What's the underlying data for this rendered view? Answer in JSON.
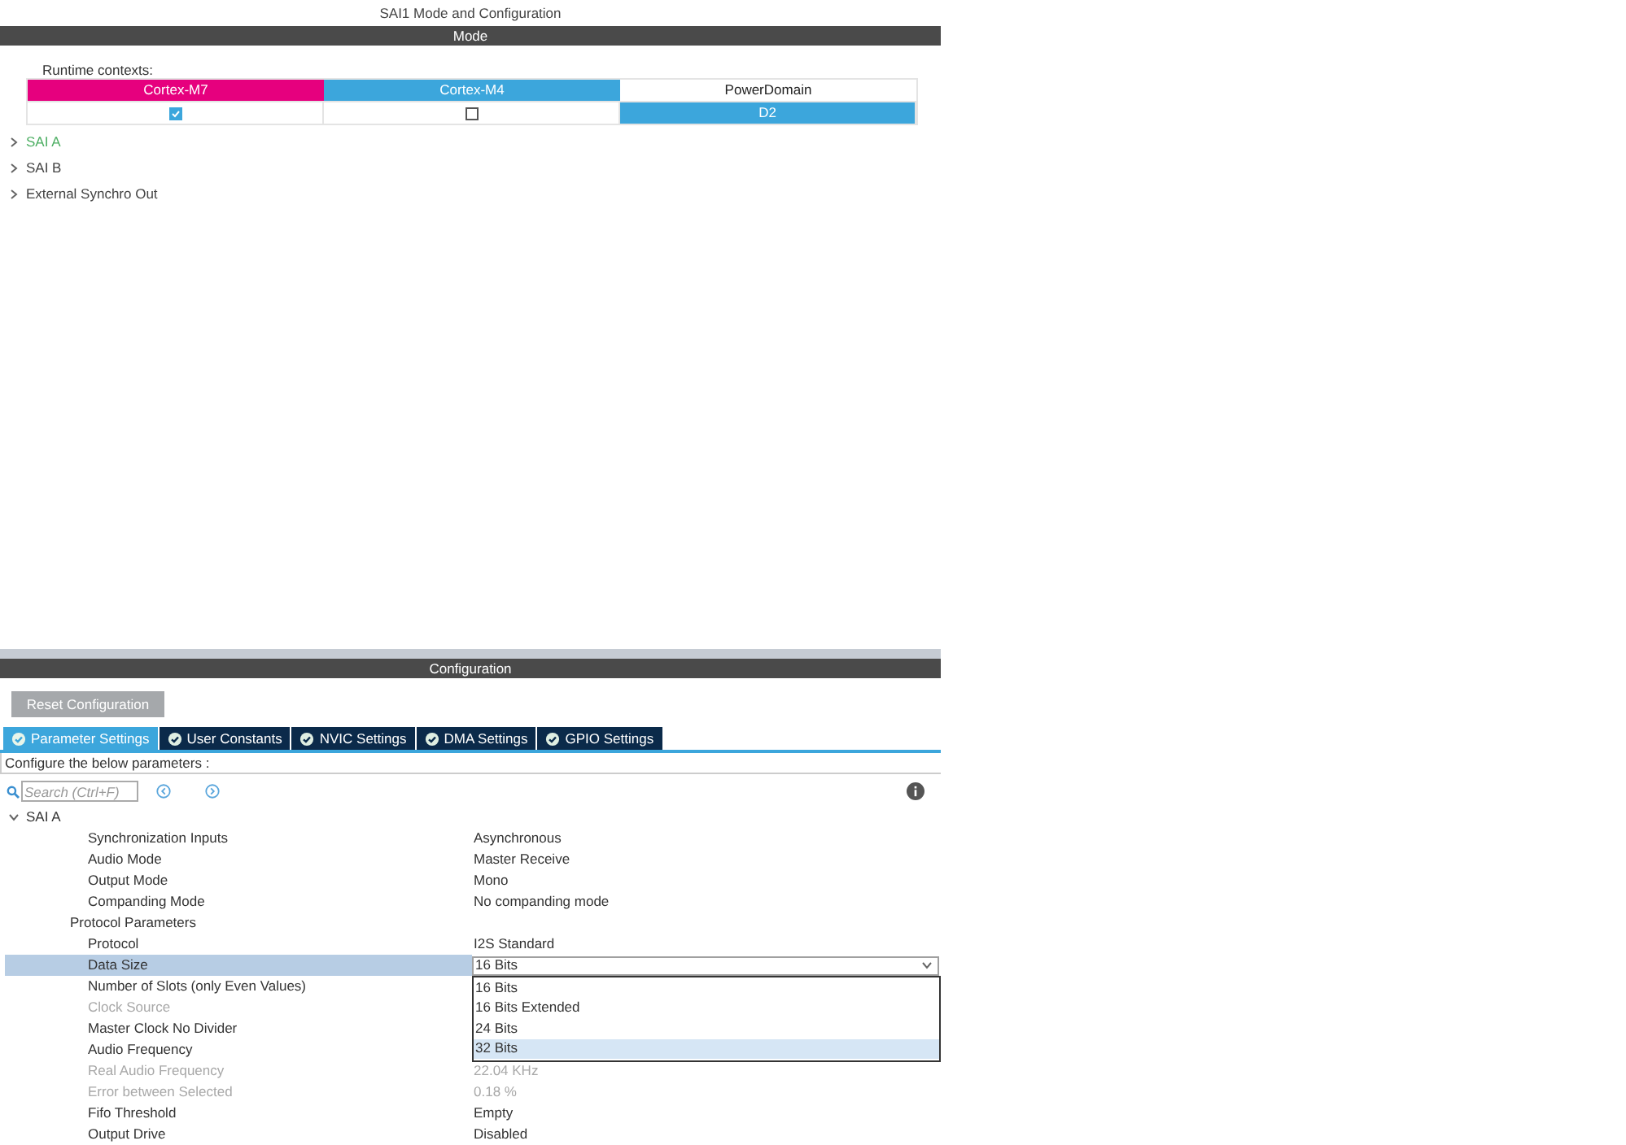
{
  "window": {
    "title": "SAI1 Mode and Configuration"
  },
  "mode": {
    "header": "Mode",
    "runtime_label": "Runtime contexts:",
    "contexts": [
      {
        "name": "Cortex-M7",
        "color": "#e6007e",
        "kind": "checkbox",
        "checked": true
      },
      {
        "name": "Cortex-M4",
        "color": "#3ca6dc",
        "kind": "checkbox",
        "checked": false
      },
      {
        "name": "PowerDomain",
        "kind": "value",
        "value": "D2"
      }
    ],
    "tree": [
      {
        "label": "SAI A",
        "configured": true,
        "expanded": false
      },
      {
        "label": "SAI B",
        "configured": false,
        "expanded": false
      },
      {
        "label": "External Synchro Out",
        "configured": false,
        "expanded": false
      }
    ]
  },
  "configuration": {
    "header": "Configuration",
    "reset_button": "Reset Configuration",
    "tabs": [
      {
        "label": "Parameter Settings",
        "selected": true
      },
      {
        "label": "User Constants",
        "selected": false
      },
      {
        "label": "NVIC Settings",
        "selected": false
      },
      {
        "label": "DMA Settings",
        "selected": false
      },
      {
        "label": "GPIO Settings",
        "selected": false
      }
    ],
    "hint": "Configure the below parameters :",
    "search": {
      "placeholder": "Search (Ctrl+F)"
    },
    "group": {
      "label": "SAI A",
      "expanded": true,
      "children": [
        {
          "label": "Synchronization Inputs",
          "value": "Asynchronous",
          "disabled": false,
          "selected": false
        },
        {
          "label": "Audio Mode",
          "value": "Master Receive",
          "disabled": false,
          "selected": false
        },
        {
          "label": "Output Mode",
          "value": "Mono",
          "disabled": false,
          "selected": false
        },
        {
          "label": "Companding Mode",
          "value": "No companding mode",
          "disabled": false,
          "selected": false
        },
        {
          "label": "Protocol Parameters",
          "kind": "group",
          "children": [
            {
              "label": "Protocol",
              "value": "I2S Standard",
              "disabled": false,
              "selected": false
            },
            {
              "label": "Data Size",
              "value": "16 Bits",
              "disabled": false,
              "selected": true,
              "dropdown": {
                "options": [
                  {
                    "label": "16 Bits",
                    "highlighted": false
                  },
                  {
                    "label": "16 Bits Extended",
                    "highlighted": false
                  },
                  {
                    "label": "24 Bits",
                    "highlighted": false
                  },
                  {
                    "label": "32 Bits",
                    "highlighted": true
                  }
                ]
              }
            },
            {
              "label": "Number of Slots (only Even Values)",
              "disabled": false,
              "selected": false
            },
            {
              "label": "Clock Source",
              "disabled": true,
              "selected": false
            },
            {
              "label": "Master Clock No Divider",
              "disabled": false,
              "selected": false
            },
            {
              "label": "Audio Frequency",
              "disabled": false,
              "selected": false
            },
            {
              "label": "Real Audio Frequency",
              "value": "22.04 KHz",
              "disabled": true,
              "selected": false
            },
            {
              "label": "Error between Selected",
              "value": "0.18 %",
              "disabled": true,
              "selected": false
            },
            {
              "label": "Fifo Threshold",
              "value": "Empty",
              "disabled": false,
              "selected": false
            },
            {
              "label": "Output Drive",
              "value": "Disabled",
              "disabled": false,
              "selected": false
            }
          ]
        }
      ]
    }
  }
}
